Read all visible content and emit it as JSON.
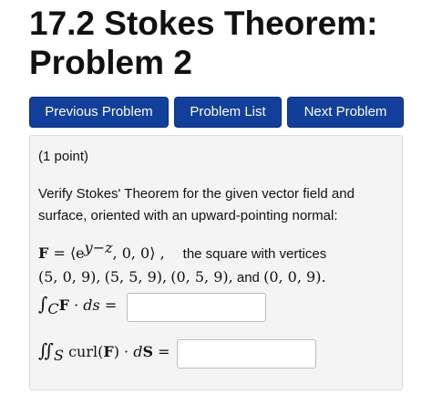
{
  "page": {
    "title": "17.2 Stokes Theorem: Problem 2"
  },
  "nav": {
    "previous_label": "Previous Problem",
    "list_label": "Problem List",
    "next_label": "Next Problem"
  },
  "problem": {
    "points": "(1 point)",
    "prompt": "Verify Stokes' Theorem for the given vector field and surface, oriented with an upward-pointing normal:",
    "field": {
      "lhs": "F",
      "eq": " = ⟨e",
      "exponent": "y−z",
      "rest": ", 0, 0⟩ ,",
      "surface_text": "the square with vertices",
      "v1": "(5, 0, 9),",
      "v2": "(5, 5, 9),",
      "v3": "(0, 5, 9),",
      "and": "and",
      "v4": "(0, 0, 9)."
    },
    "line_integral": {
      "integral": "∫",
      "subscript": "C",
      "vec": "F",
      "dot": " · ",
      "ds": "ds",
      "eq": " ="
    },
    "surface_integral": {
      "integral": "∬",
      "subscript": "S",
      "curl": " curl(",
      "vec": "F",
      "close": ") · ",
      "d": "d",
      "dS": "S",
      "eq": " ="
    },
    "answers": {
      "line_value": "",
      "surface_value": ""
    }
  },
  "colors": {
    "button_bg": "#123f9a",
    "box_bg": "#f4f4f4"
  }
}
